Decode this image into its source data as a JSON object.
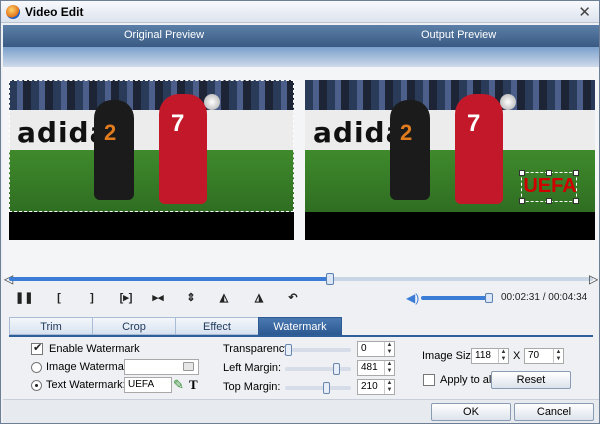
{
  "window": {
    "title": "Video Edit",
    "close_glyph": "✕"
  },
  "preview": {
    "original_label": "Original Preview",
    "output_label": "Output Preview"
  },
  "video": {
    "board_text": "adidas",
    "player1_number": "2",
    "player2_number": "7",
    "watermark_overlay": "UEFA"
  },
  "playback": {
    "seek_progress_percent": 55,
    "volume_percent": 95,
    "current_time": "00:02:31",
    "separator": "/",
    "total_time": "00:04:34"
  },
  "controls": {
    "pause": "❚❚",
    "mark_in": "[",
    "mark_out": "]",
    "play_segment": "[▸]",
    "icons": [
      "pause-icon",
      "mark-in-icon",
      "mark-out-icon",
      "play-segment-icon",
      "split-icon",
      "flip-vertical-icon",
      "flip-horizontal-icon",
      "rotate-left-icon",
      "rotate-right-icon",
      "undo-icon"
    ]
  },
  "tabs": [
    {
      "label": "Trim",
      "active": false
    },
    {
      "label": "Crop",
      "active": false
    },
    {
      "label": "Effect",
      "active": false
    },
    {
      "label": "Watermark",
      "active": true
    }
  ],
  "watermark": {
    "enable_label": "Enable Watermark",
    "enable_checked": true,
    "image_label": "Image Watermark:",
    "image_value": "",
    "text_label": "Text Watermark:",
    "text_value": "UEFA",
    "mode": "text",
    "transparency_label": "Transparency:",
    "transparency_value": "0",
    "left_margin_label": "Left Margin:",
    "left_margin_value": "481",
    "top_margin_label": "Top  Margin:",
    "top_margin_value": "210",
    "image_size_label": "Image Size:",
    "image_width": "118",
    "size_separator": "X",
    "image_height": "70",
    "apply_all_label": "Apply to all",
    "apply_all_checked": false,
    "reset_label": "Reset"
  },
  "footer": {
    "ok_label": "OK",
    "cancel_label": "Cancel"
  },
  "colors": {
    "accent": "#3b7dd6",
    "header": "#3a5a83",
    "watermark_text": "#d10000"
  }
}
